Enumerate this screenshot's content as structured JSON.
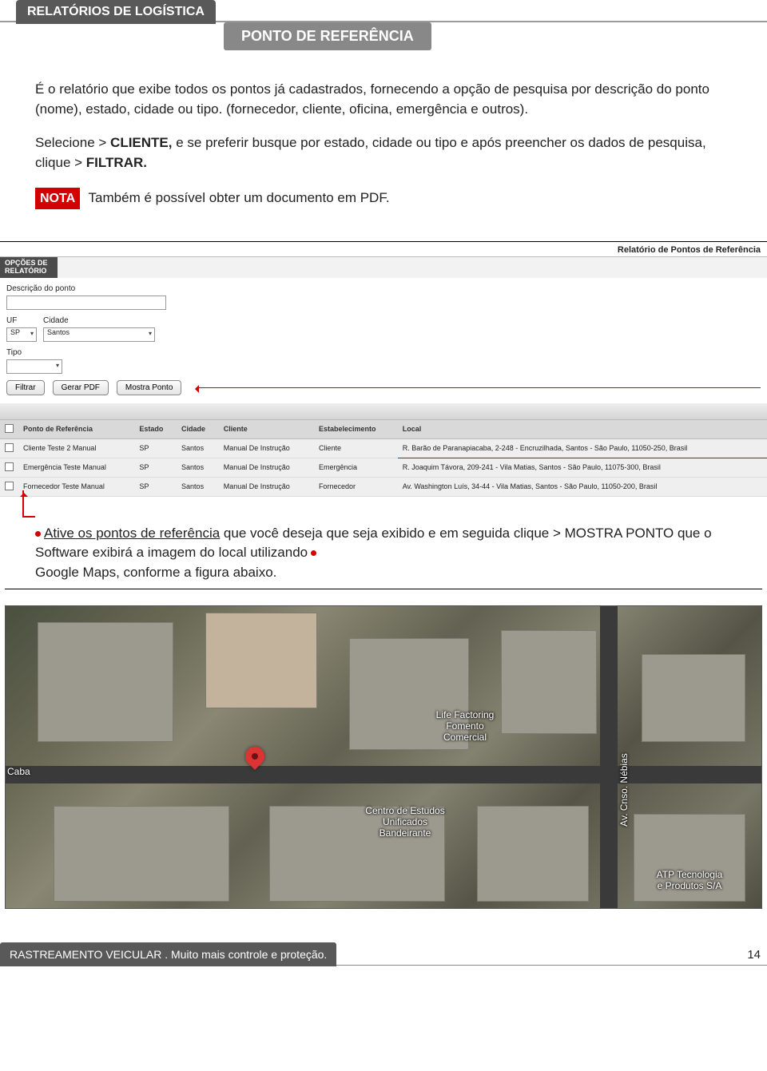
{
  "header": {
    "tab1": "RELATÓRIOS DE LOGÍSTICA",
    "tab2": "PONTO DE REFERÊNCIA"
  },
  "body": {
    "p1": "É o relatório que exibe todos os pontos já cadastrados, fornecendo a opção de pesquisa por descrição do ponto (nome), estado, cidade ou tipo. (fornecedor, cliente, oficina, emergência e outros).",
    "p2_pre": "Selecione > ",
    "p2_b1": "CLIENTE,",
    "p2_mid": " e se preferir busque por estado, cidade ou tipo e após preencher os dados de pesquisa, clique > ",
    "p2_b2": "FILTRAR.",
    "nota_label": "NOTA",
    "nota_text": " Também é possível obter um documento em PDF."
  },
  "shot1": {
    "title": "Relatório de Pontos de Referência",
    "opt_label": "OPÇÕES DE RELATÓRIO",
    "labels": {
      "descricao": "Descrição do ponto",
      "uf": "UF",
      "cidade": "Cidade",
      "tipo": "Tipo"
    },
    "values": {
      "uf": "SP",
      "cidade": "Santos"
    },
    "buttons": {
      "filtrar": "Filtrar",
      "gerar": "Gerar PDF",
      "mostra": "Mostra Ponto"
    },
    "columns": [
      "",
      "Ponto de Referência",
      "Estado",
      "Cidade",
      "Cliente",
      "Estabelecimento",
      "Local"
    ],
    "rows": [
      {
        "ponto": "Cliente Teste 2 Manual",
        "estado": "SP",
        "cidade": "Santos",
        "cliente": "Manual De Instrução",
        "estab": "Cliente",
        "local": "R. Barão de Paranapiacaba, 2-248 - Encruzilhada, Santos - São Paulo, 11050-250, Brasil"
      },
      {
        "ponto": "Emergência Teste Manual",
        "estado": "SP",
        "cidade": "Santos",
        "cliente": "Manual De Instrução",
        "estab": "Emergência",
        "local": "R. Joaquim Távora, 209-241 - Vila Matias, Santos - São Paulo, 11075-300, Brasil"
      },
      {
        "ponto": "Fornecedor Teste Manual",
        "estado": "SP",
        "cidade": "Santos",
        "cliente": "Manual De Instrução",
        "estab": "Fornecedor",
        "local": "Av. Washington Luís, 34-44 - Vila Matias, Santos - São Paulo, 11050-200, Brasil"
      }
    ]
  },
  "annotation": {
    "underline": "Ative os pontos de referência",
    "rest1": " que você deseja que seja exibido e em seguida clique > MOSTRA PONTO que o Software exibirá a imagem do local utilizando",
    "rest2": "Google Maps, conforme a figura abaixo."
  },
  "map": {
    "caba": "Caba",
    "l1": "Life Factoring\nFomento\nComercial",
    "l2": "Centro de Estudos\nUnificados\nBandeirante",
    "l3": "Av. Cnso. Nébias",
    "l4": "ATP Tecnologia\ne Produtos S/A"
  },
  "footer": {
    "text": "RASTREAMENTO VEICULAR . Muito mais controle e proteção.",
    "page": "14"
  }
}
